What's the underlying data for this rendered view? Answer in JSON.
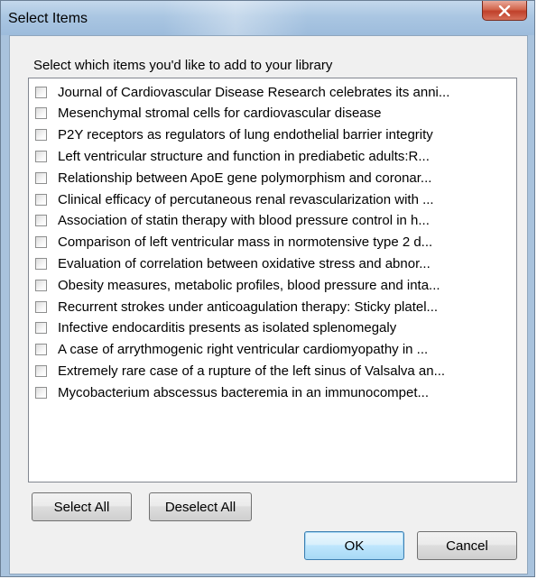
{
  "window": {
    "title": "Select Items"
  },
  "dialog": {
    "prompt": "Select which items you'd like to add to your library",
    "items": [
      {
        "label": "Journal of Cardiovascular Disease Research celebrates its anni...",
        "checked": false
      },
      {
        "label": "Mesenchymal stromal cells for cardiovascular disease",
        "checked": false
      },
      {
        "label": "P2Y receptors as regulators of lung endothelial barrier integrity",
        "checked": false
      },
      {
        "label": "Left ventricular structure and function in prediabetic adults:R...",
        "checked": false
      },
      {
        "label": "Relationship between ApoE gene polymorphism and coronar...",
        "checked": false
      },
      {
        "label": "Clinical efficacy of percutaneous renal revascularization with ...",
        "checked": false
      },
      {
        "label": "Association of statin therapy with blood pressure control in h...",
        "checked": false
      },
      {
        "label": "Comparison of left ventricular mass in normotensive type 2 d...",
        "checked": false
      },
      {
        "label": "Evaluation of correlation between oxidative stress and abnor...",
        "checked": false
      },
      {
        "label": "Obesity measures, metabolic profiles, blood pressure and inta...",
        "checked": false
      },
      {
        "label": "Recurrent strokes under anticoagulation therapy: Sticky platel...",
        "checked": false
      },
      {
        "label": "Infective endocarditis presents as isolated splenomegaly",
        "checked": false
      },
      {
        "label": "A case of arrythmogenic right ventricular cardiomyopathy in ...",
        "checked": false
      },
      {
        "label": "Extremely rare case of a rupture of the left sinus of Valsalva an...",
        "checked": false
      },
      {
        "label": "Mycobacterium abscessus bacteremia in an immunocompet...",
        "checked": false
      }
    ],
    "select_all_label": "Select All",
    "deselect_all_label": "Deselect All",
    "ok_label": "OK",
    "cancel_label": "Cancel"
  },
  "colors": {
    "titlebar": "#aac6e2",
    "close_button": "#c0402a",
    "client_background": "#f0f0f0",
    "default_button_border": "#3c7fb1"
  },
  "icons": {
    "close": "close-x-icon",
    "checkbox": "checkbox-unchecked"
  }
}
